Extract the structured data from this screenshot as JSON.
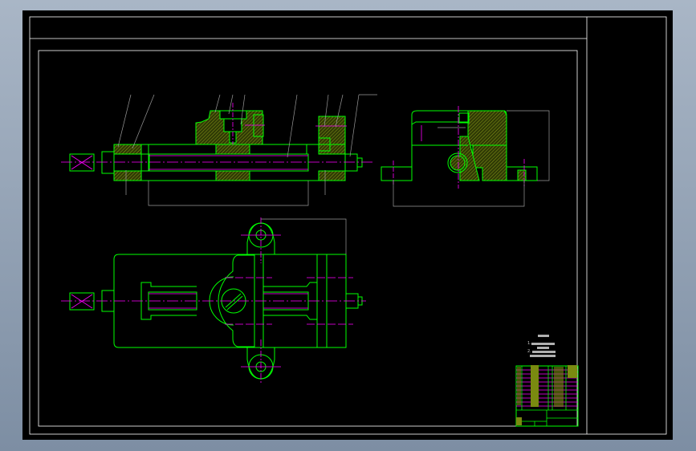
{
  "viewport": {
    "background": "#000000",
    "outer_background": "#8e9db1"
  },
  "colors": {
    "outline": "#00ff00",
    "centerline": "#ff00ff",
    "dimension": "#9a9a9a",
    "hatch": "#6b7a10",
    "frame": "#ffffff"
  },
  "notes": {
    "item1": "1.",
    "item2": "2."
  },
  "views": [
    "front-section-view",
    "side-section-view",
    "top-view"
  ]
}
